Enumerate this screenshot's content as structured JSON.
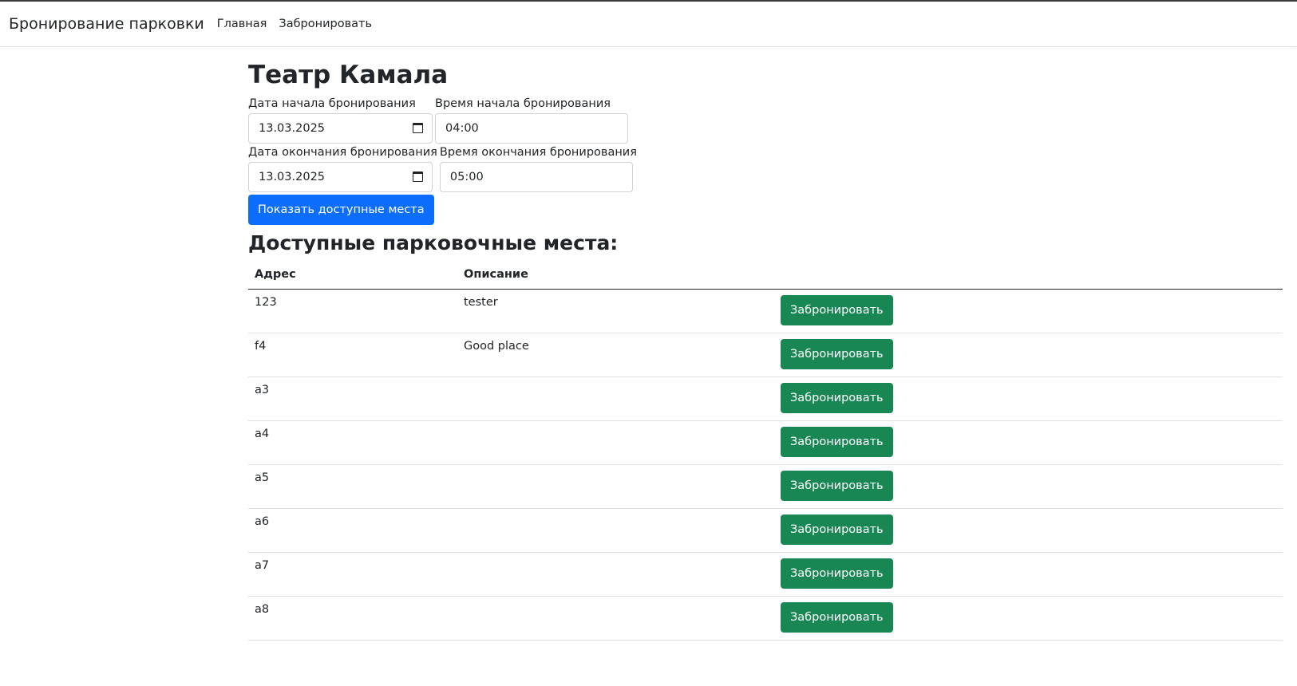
{
  "navbar": {
    "brand": "Бронирование парковки",
    "links": [
      "Главная",
      "Забронировать"
    ]
  },
  "page": {
    "title": "Театр Камала"
  },
  "form": {
    "start_date_label": "Дата начала бронирования",
    "start_date_value": "13.03.2025",
    "start_time_label": "Время начала бронирования",
    "start_time_value": "04:00",
    "end_date_label": "Дата окончания бронирования",
    "end_date_value": "13.03.2025",
    "end_time_label": "Время окончания бронирования",
    "end_time_value": "05:00",
    "submit_label": "Показать доступные места"
  },
  "spots": {
    "title": "Доступные парковочные места:",
    "columns": [
      "Адрес",
      "Описание",
      ""
    ],
    "book_label": "Забронировать",
    "rows": [
      {
        "address": "123",
        "description": "tester"
      },
      {
        "address": "f4",
        "description": "Good place"
      },
      {
        "address": "a3",
        "description": ""
      },
      {
        "address": "a4",
        "description": ""
      },
      {
        "address": "a5",
        "description": ""
      },
      {
        "address": "a6",
        "description": ""
      },
      {
        "address": "a7",
        "description": ""
      },
      {
        "address": "a8",
        "description": ""
      }
    ]
  },
  "colors": {
    "primary": "#0d6efd",
    "success": "#198754",
    "text": "#212529"
  }
}
